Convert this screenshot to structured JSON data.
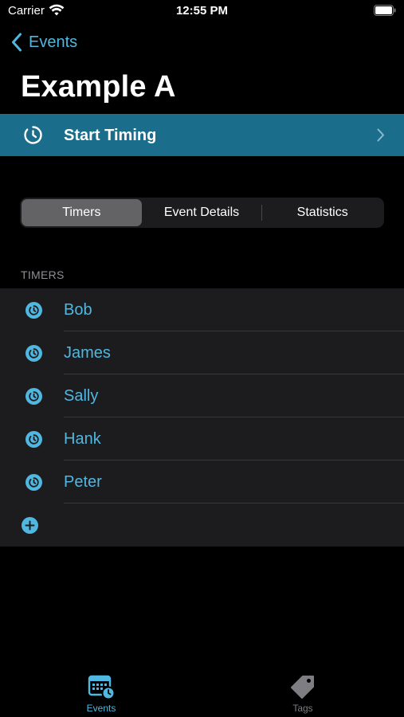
{
  "status_bar": {
    "carrier": "Carrier",
    "time": "12:55 PM"
  },
  "nav": {
    "back_label": "Events",
    "title": "Example A"
  },
  "start_timing": {
    "label": "Start Timing"
  },
  "segments": [
    {
      "label": "Timers",
      "selected": true
    },
    {
      "label": "Event Details",
      "selected": false
    },
    {
      "label": "Statistics",
      "selected": false
    }
  ],
  "timers_section": {
    "header": "TIMERS",
    "items": [
      {
        "name": "Bob"
      },
      {
        "name": "James"
      },
      {
        "name": "Sally"
      },
      {
        "name": "Hank"
      },
      {
        "name": "Peter"
      }
    ]
  },
  "tab_bar": {
    "events_label": "Events",
    "tags_label": "Tags",
    "selected": "events"
  },
  "colors": {
    "accent": "#4fb7e0",
    "start_row_bg": "#1a6e8b",
    "background": "#000000",
    "grouped_bg": "#1c1c1e"
  }
}
